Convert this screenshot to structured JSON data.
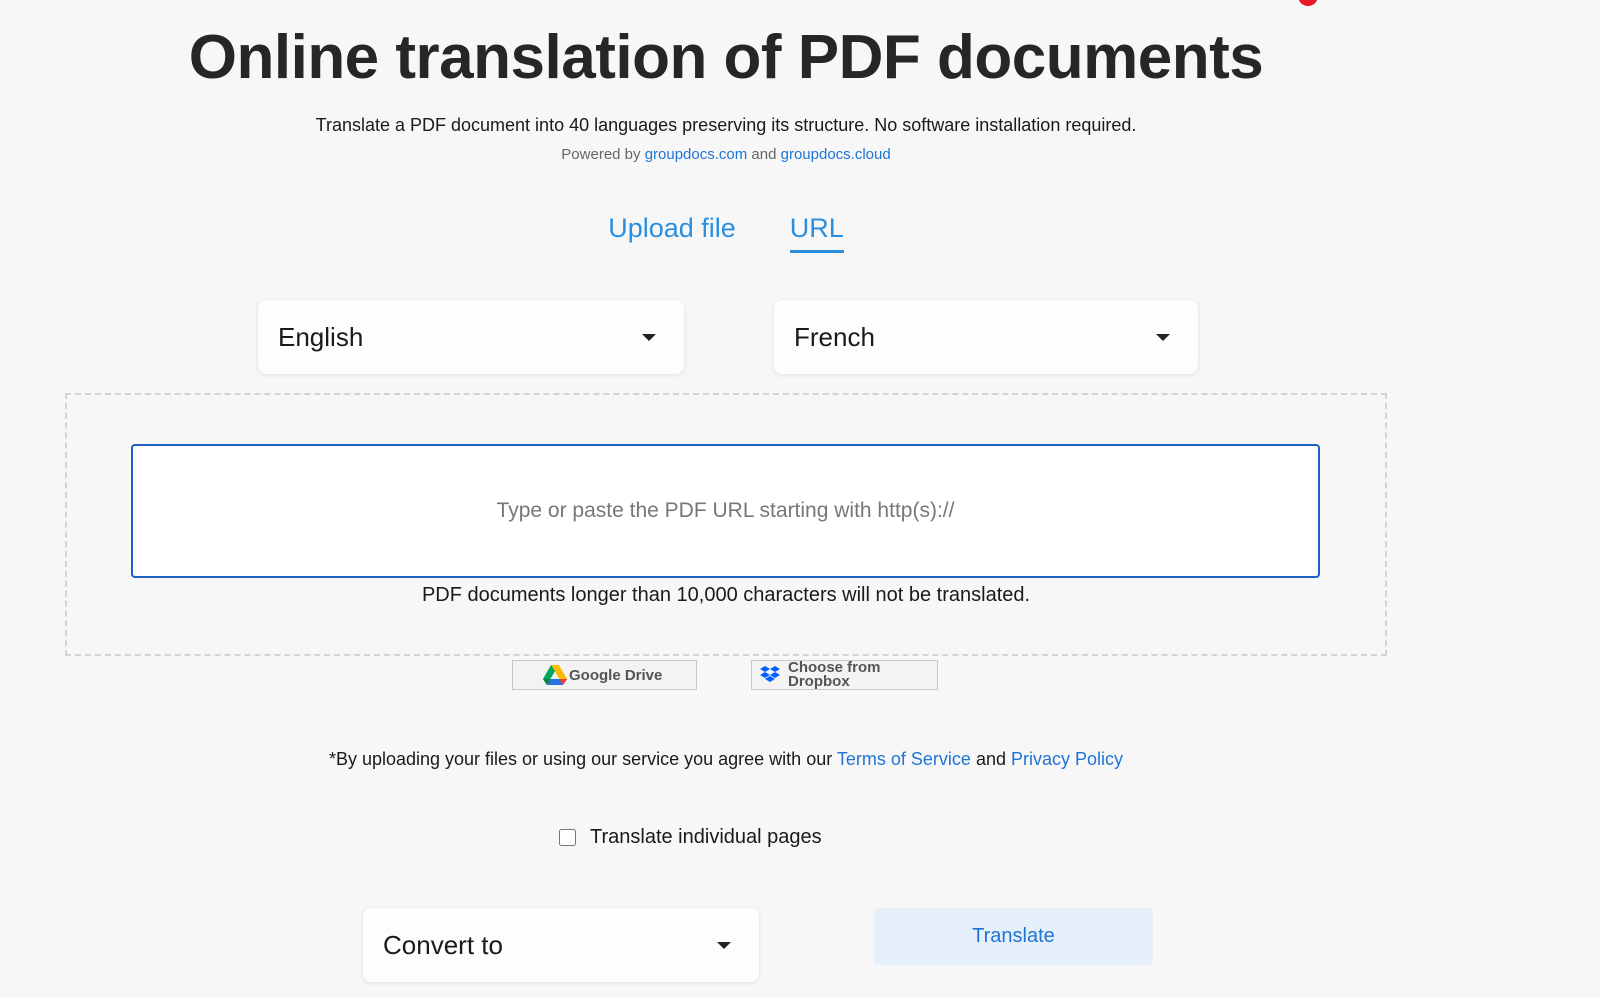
{
  "header": {
    "title": "Online translation of PDF documents",
    "subtitle": "Translate a PDF document into 40 languages preserving its structure. No software installation required.",
    "powered_prefix": "Powered by",
    "powered_link_1": "groupdocs.com",
    "powered_and": "and",
    "powered_link_2": "groupdocs.cloud"
  },
  "tabs": {
    "upload_label": "Upload file",
    "url_label": "URL",
    "active": "URL"
  },
  "languages": {
    "source": "English",
    "target": "French"
  },
  "url_input": {
    "placeholder": "Type or paste the PDF URL starting with http(s)://",
    "value": ""
  },
  "limit_note": "PDF documents longer than 10,000 characters will not be translated.",
  "cloud": {
    "gdrive_label": "Google Drive",
    "dropbox_line1": "Choose from",
    "dropbox_line2": "Dropbox"
  },
  "agreement": {
    "prefix": "*By uploading your files or using our service you agree with our",
    "terms": "Terms of Service",
    "and": "and",
    "privacy": "Privacy Policy"
  },
  "options": {
    "individual_pages_label": "Translate individual pages",
    "individual_pages_checked": false
  },
  "convert": {
    "label": "Convert to"
  },
  "actions": {
    "translate_label": "Translate"
  },
  "colors": {
    "link": "#1f74d6",
    "tab": "#2b8fe0",
    "input_border": "#1f5fc4",
    "translate_bg": "#e5f0fb"
  }
}
